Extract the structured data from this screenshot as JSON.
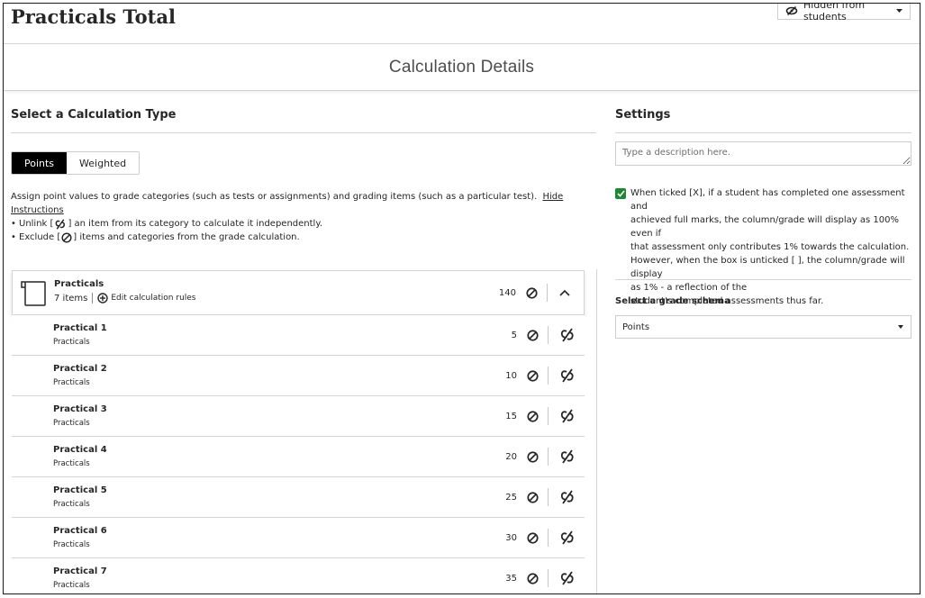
{
  "header": {
    "page_title": "Practicals Total",
    "visibility_label": "Hidden from students",
    "section_title": "Calculation Details"
  },
  "calculation": {
    "title": "Select a Calculation Type",
    "types": [
      {
        "label": "Points",
        "selected": true
      },
      {
        "label": "Weighted",
        "selected": false
      }
    ],
    "instructions": {
      "text": "Assign point values to grade categories (such as tests or assignments) and grading items (such as a particular test).",
      "hide_link": "Hide Instructions",
      "bullet_unlink_before": "Unlink [",
      "bullet_unlink_after": "] an item from its category to calculate it independently.",
      "bullet_exclude_before": "Exclude [",
      "bullet_exclude_after": "] items and categories from the grade calculation."
    },
    "category": {
      "name": "Practicals",
      "items_count": "7 items",
      "edit_rules_label": "Edit calculation rules",
      "points": "140"
    },
    "items": [
      {
        "name": "Practical 1",
        "category": "Practicals",
        "points": "5"
      },
      {
        "name": "Practical 2",
        "category": "Practicals",
        "points": "10"
      },
      {
        "name": "Practical 3",
        "category": "Practicals",
        "points": "15"
      },
      {
        "name": "Practical 4",
        "category": "Practicals",
        "points": "20"
      },
      {
        "name": "Practical 5",
        "category": "Practicals",
        "points": "25"
      },
      {
        "name": "Practical 6",
        "category": "Practicals",
        "points": "30"
      },
      {
        "name": "Practical 7",
        "category": "Practicals",
        "points": "35"
      }
    ]
  },
  "settings": {
    "title": "Settings",
    "description_placeholder": "Type a description here.",
    "checkbox_checked": true,
    "checkbox_lines": [
      "When ticked [X], if a student has completed one assessment and",
      "achieved full marks, the column/grade will display as 100% even if",
      "that assessment only contributes 1% towards the calculation.",
      "However, when the box is unticked [ ], the column/grade will display",
      "as 1% - a reflection of the",
      "student's completed assessments thus far."
    ],
    "schema_label": "Select a grade schema",
    "schema_value": "Points"
  },
  "colors": {
    "active_segment": "#000000",
    "checkbox": "#1a8a2f",
    "border": "#d4d4d4"
  },
  "icons": [
    "eye-slash-icon",
    "caret-down-icon",
    "category-book-icon",
    "plus-circle-icon",
    "exclude-icon",
    "chevron-up-icon",
    "unlink-icon"
  ]
}
